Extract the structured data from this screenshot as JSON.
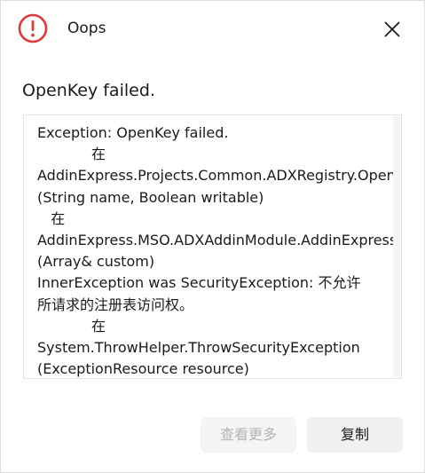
{
  "dialog": {
    "title": "Oops",
    "heading": "OpenKey failed.",
    "message": "Exception: OpenKey failed.\n            在\nAddinExpress.Projects.Common.ADXRegistry.OpenKey\n(String name, Boolean writable)\n   在\nAddinExpress.MSO.ADXAddinModule.AddinExpress\n(Array& custom)\nInnerException was SecurityException: 不允许\n所请求的注册表访问权。\n            在\nSystem.ThrowHelper.ThrowSecurityException\n(ExceptionResource resource)",
    "buttons": {
      "more_label": "查看更多",
      "copy_label": "复制"
    }
  },
  "icons": {
    "error": "error-circle-icon",
    "close": "close-icon"
  },
  "colors": {
    "error_red": "#e0393e",
    "button_bg": "#f0f0f0",
    "disabled_text": "#b3b3b3"
  }
}
